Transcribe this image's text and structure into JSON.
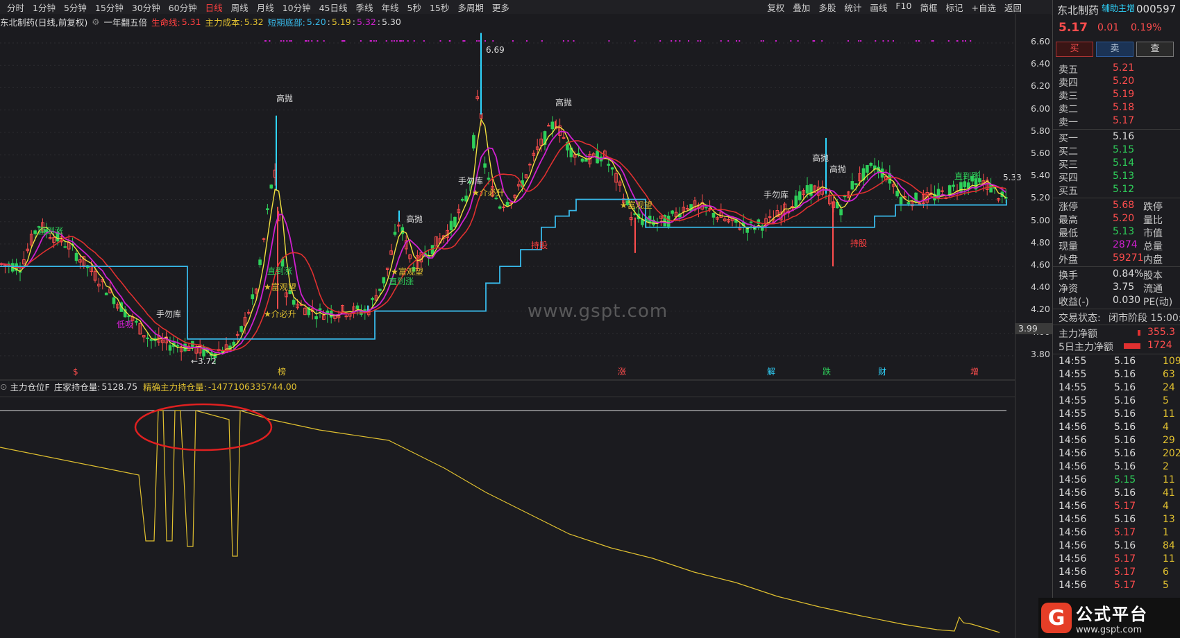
{
  "toolbar": {
    "periods": [
      "分时",
      "1分钟",
      "5分钟",
      "15分钟",
      "30分钟",
      "60分钟",
      "日线",
      "周线",
      "月线",
      "10分钟",
      "45日线",
      "季线",
      "年线",
      "5秒",
      "15秒",
      "多周期",
      "更多"
    ],
    "active_period": "日线",
    "right_items": [
      "复权",
      "叠加",
      "多股",
      "统计",
      "画线",
      "F10",
      "简框",
      "标记",
      "+自选",
      "返回"
    ]
  },
  "main_info": {
    "stock_label": "东北制药(日线,前复权)",
    "formula_name": "一年翻五倍",
    "lifeline_label": "生命线:",
    "lifeline_value": "5.31",
    "cost_label": "主力成本:",
    "cost_value": "5.32",
    "bottom_label": "短期底部:",
    "bottom_v1": "5.20",
    "bottom_v2": "5.19",
    "bottom_v3": "5.32",
    "bottom_v4": "5.30"
  },
  "price_axis": [
    "6.60",
    "6.40",
    "6.20",
    "6.00",
    "5.80",
    "5.60",
    "5.40",
    "5.20",
    "5.00",
    "4.80",
    "4.60",
    "4.40",
    "4.20",
    "4.00",
    "3.80"
  ],
  "current_price_tag": "3.99",
  "annotations": {
    "high_peak": "6.69",
    "low_point": "3.72",
    "right_last": "5.33",
    "gaopao": "高抛",
    "shouwuku": "手勿库",
    "zhidaozhang": "直到涨",
    "jieshenzhu": "★介必升",
    "huiguanwang": "★富观望",
    "chigu": "持股",
    "dixi": "低吸"
  },
  "event_markers": [
    "$",
    "榜",
    "涨",
    "解",
    "跌",
    "财",
    "增"
  ],
  "sub_info": {
    "indicator": "主力仓位F",
    "holding_label": "庄家持仓量:",
    "holding_value": "5128.75",
    "precise_label": "精确主力持仓量:",
    "precise_value": "-1477106335744.00"
  },
  "watermark": "www.gspt.com",
  "sidebar": {
    "name": "东北制药",
    "badge": "辅助主增",
    "code": "000597",
    "price": "5.17",
    "change": "0.01",
    "change_pct": "0.19%",
    "buttons": {
      "buy": "买",
      "sell": "卖",
      "query": "查"
    },
    "asks": [
      {
        "label": "卖五",
        "price": "5.21"
      },
      {
        "label": "卖四",
        "price": "5.20"
      },
      {
        "label": "卖三",
        "price": "5.19"
      },
      {
        "label": "卖二",
        "price": "5.18"
      },
      {
        "label": "卖一",
        "price": "5.17"
      }
    ],
    "bids": [
      {
        "label": "买一",
        "price": "5.16"
      },
      {
        "label": "买二",
        "price": "5.15"
      },
      {
        "label": "买三",
        "price": "5.14"
      },
      {
        "label": "买四",
        "price": "5.13"
      },
      {
        "label": "买五",
        "price": "5.12"
      }
    ],
    "stats": [
      {
        "label": "涨停",
        "value": "5.68",
        "extra": "跌停"
      },
      {
        "label": "最高",
        "value": "5.20",
        "extra": "量比"
      },
      {
        "label": "最低",
        "value": "5.13",
        "extra": "市值"
      },
      {
        "label": "现量",
        "value": "2874",
        "extra": "总量"
      },
      {
        "label": "外盘",
        "value": "59271",
        "extra": "内盘"
      }
    ],
    "stats2": [
      {
        "label": "换手",
        "value": "0.84%",
        "extra": "股本"
      },
      {
        "label": "净资",
        "value": "3.75",
        "extra": "流通"
      },
      {
        "label": "收益(-)",
        "value": "0.030",
        "extra": "PE(动)"
      }
    ],
    "trade_status_label": "交易状态:",
    "trade_status": "闭市阶段 15:00:",
    "net_flow_label": "主力净额",
    "net_flow_value": "355.3",
    "net_flow5_label": "5日主力净额",
    "net_flow5_value": "1724",
    "trades": [
      {
        "t": "14:55",
        "p": "5.16",
        "v": "109",
        "c": "#ddd"
      },
      {
        "t": "14:55",
        "p": "5.16",
        "v": "63",
        "c": "#ddd"
      },
      {
        "t": "14:55",
        "p": "5.16",
        "v": "24",
        "c": "#ddd"
      },
      {
        "t": "14:55",
        "p": "5.16",
        "v": "5",
        "c": "#ddd"
      },
      {
        "t": "14:55",
        "p": "5.16",
        "v": "11",
        "c": "#ddd"
      },
      {
        "t": "14:56",
        "p": "5.16",
        "v": "4",
        "c": "#ddd"
      },
      {
        "t": "14:56",
        "p": "5.16",
        "v": "29",
        "c": "#ddd"
      },
      {
        "t": "14:56",
        "p": "5.16",
        "v": "202",
        "c": "#ddd"
      },
      {
        "t": "14:56",
        "p": "5.16",
        "v": "2",
        "c": "#ddd"
      },
      {
        "t": "14:56",
        "p": "5.15",
        "v": "11",
        "c": "#2ed05a"
      },
      {
        "t": "14:56",
        "p": "5.16",
        "v": "41",
        "c": "#ddd"
      },
      {
        "t": "14:56",
        "p": "5.17",
        "v": "4",
        "c": "#ff4d4d"
      },
      {
        "t": "14:56",
        "p": "5.16",
        "v": "13",
        "c": "#ddd"
      },
      {
        "t": "14:56",
        "p": "5.17",
        "v": "1",
        "c": "#ff4d4d"
      },
      {
        "t": "14:56",
        "p": "5.16",
        "v": "84",
        "c": "#ddd"
      },
      {
        "t": "14:56",
        "p": "5.17",
        "v": "11",
        "c": "#ff4d4d"
      },
      {
        "t": "14:56",
        "p": "5.17",
        "v": "6",
        "c": "#ff4d4d"
      },
      {
        "t": "14:56",
        "p": "5.17",
        "v": "5",
        "c": "#ff4d4d"
      }
    ]
  },
  "logo": {
    "main": "公式平台",
    "url": "www.gspt.com",
    "mark": "G"
  },
  "colors": {
    "up": "#ff4d4d",
    "down": "#2ed05a",
    "yellow": "#e0c030",
    "magenta": "#d020d0",
    "cyan": "#38b8e8",
    "red": "#e03030"
  }
}
